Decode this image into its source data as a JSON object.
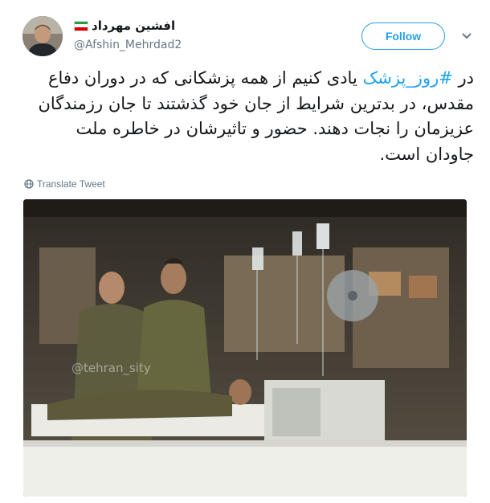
{
  "tweet": {
    "display_name": "افشین مهرداد",
    "handle": "@Afshin_Mehrdad2",
    "follow_label": "Follow",
    "text_prefix": "در ",
    "hashtag": "#روز_پزشک",
    "text_rest": " یادی کنیم از همه پزشکانی که در دوران دفاع مقدس، در بدترین شرایط از جان خود گذشتند تا جان رزمندگان عزیزمان را نجات دهند. حضور و تاثیرشان در خاطره ملت جاودان است.",
    "translate_label": "Translate Tweet",
    "photo_watermark": "@tehran_sity"
  },
  "icons": {
    "avatar": "avatar",
    "flag": "iran-flag-icon",
    "more": "chevron-down-icon",
    "translate": "globe-icon"
  },
  "colors": {
    "accent": "#1da1f2",
    "text": "#14171a",
    "muted": "#657786",
    "flag_green": "#239f40",
    "flag_white": "#ffffff",
    "flag_red": "#da0000"
  }
}
